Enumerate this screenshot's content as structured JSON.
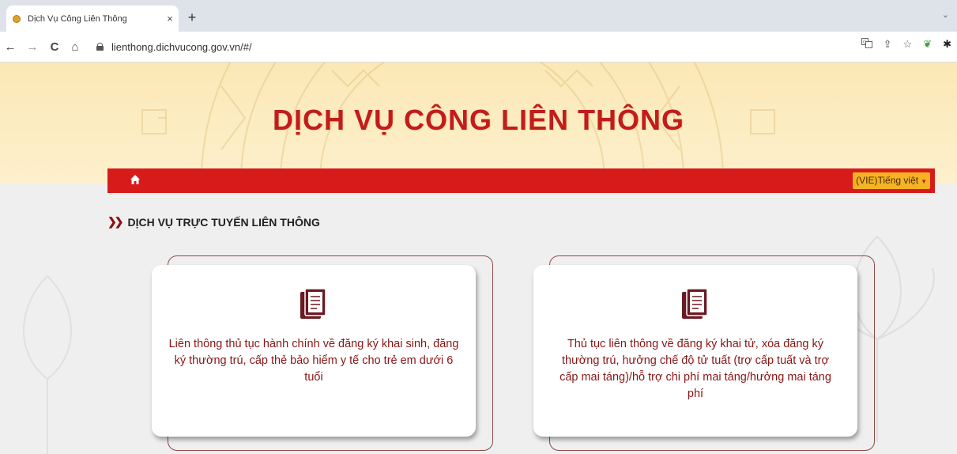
{
  "browser": {
    "tab_title": "Dịch Vụ Công Liên Thông",
    "tab_close": "×",
    "new_tab": "+",
    "url": "lienthong.dichvucong.gov.vn/#/",
    "nav": {
      "back": "←",
      "forward": "→",
      "reload": "C",
      "home": "⌂"
    },
    "toolbar_icons": [
      "translate-icon",
      "share-icon",
      "star-icon",
      "extension-icon",
      "puzzle-icon"
    ]
  },
  "header": {
    "site_title": "DỊCH VỤ CÔNG LIÊN THÔNG"
  },
  "navbar": {
    "home_icon": "home-icon",
    "language": "(VIE)Tiếng việt"
  },
  "main": {
    "section_title": "DỊCH VỤ TRỰC TUYẾN LIÊN THÔNG",
    "cards": [
      {
        "icon": "document-icon",
        "text": "Liên thông thủ tục hành chính về đăng ký khai sinh, đăng ký thường trú, cấp thẻ bảo hiểm y tế cho trẻ em dưới 6 tuổi"
      },
      {
        "icon": "document-icon",
        "text": "Thủ tục liên thông về đăng ký khai tử, xóa đăng ký thường trú, hưởng chế độ tử tuất (trợ cấp tuất và trợ cấp mai táng)/hỗ trợ chi phí mai táng/hưởng mai táng phí"
      }
    ]
  },
  "colors": {
    "brand_red": "#d71b1b",
    "title_red": "#c21c1c",
    "banner": "#fbe8b6",
    "lang_bg": "#f5b324",
    "card_text": "#8a1515"
  }
}
